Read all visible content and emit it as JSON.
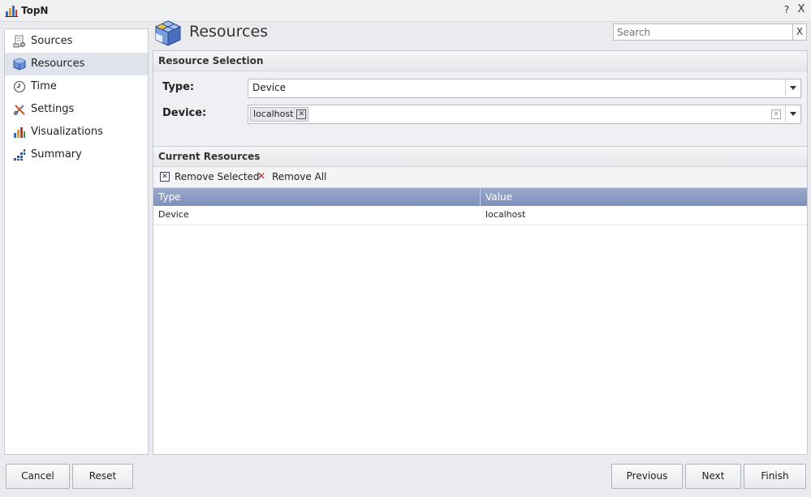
{
  "window": {
    "title": "TopN",
    "help_glyph": "?",
    "close_glyph": "X"
  },
  "sidebar": {
    "items": [
      {
        "label": "Sources",
        "icon": "sources-icon",
        "active": false
      },
      {
        "label": "Resources",
        "icon": "resources-icon",
        "active": true
      },
      {
        "label": "Time",
        "icon": "clock-icon",
        "active": false
      },
      {
        "label": "Settings",
        "icon": "settings-icon",
        "active": false
      },
      {
        "label": "Visualizations",
        "icon": "bar-chart-icon",
        "active": false
      },
      {
        "label": "Summary",
        "icon": "summary-icon",
        "active": false
      }
    ]
  },
  "header": {
    "title": "Resources",
    "search": {
      "placeholder": "Search",
      "value": "",
      "clear_glyph": "X"
    }
  },
  "resource_selection": {
    "title": "Resource Selection",
    "type_label": "Type:",
    "type_value": "Device",
    "device_label": "Device:",
    "device_tags": [
      "localhost"
    ]
  },
  "current_resources": {
    "title": "Current Resources",
    "remove_selected_label": "Remove Selected",
    "remove_all_label": "Remove All",
    "columns": [
      "Type",
      "Value"
    ],
    "rows": [
      {
        "type": "Device",
        "value": "localhost"
      }
    ]
  },
  "footer": {
    "cancel_label": "Cancel",
    "reset_label": "Reset",
    "previous_label": "Previous",
    "next_label": "Next",
    "finish_label": "Finish"
  },
  "colors": {
    "accent_header": "#8090bd",
    "active_nav": "#dfe4ec",
    "remove_all_icon": "#cc2222"
  }
}
